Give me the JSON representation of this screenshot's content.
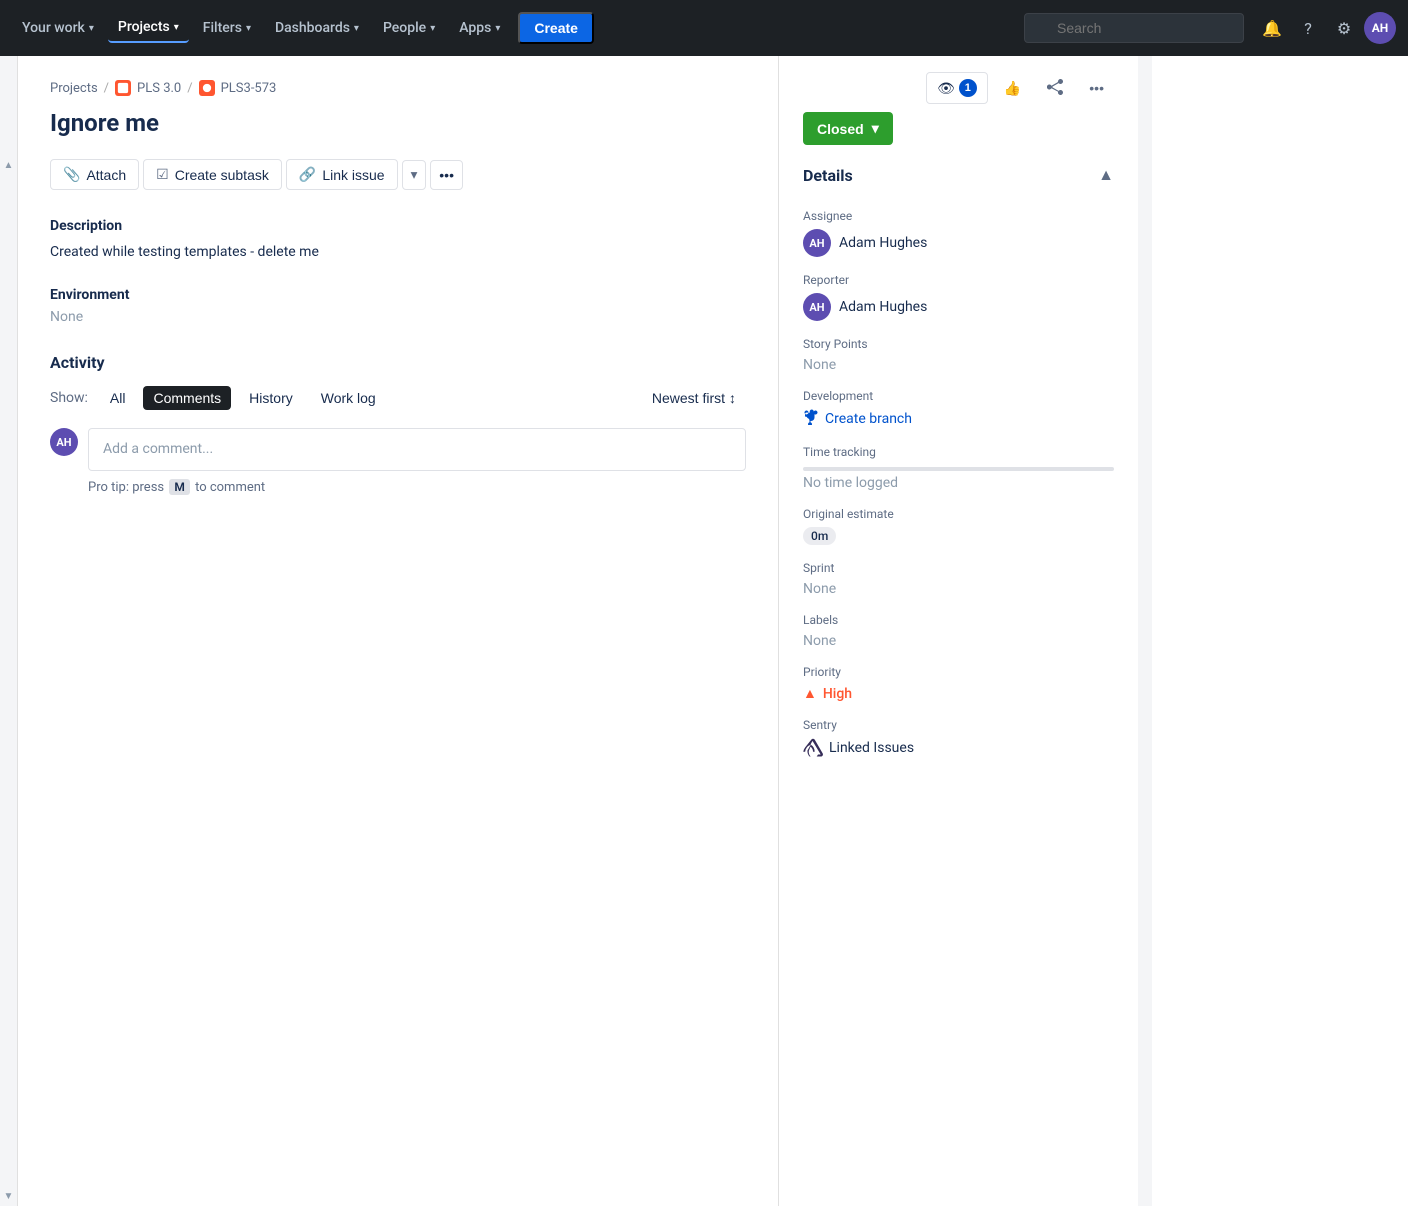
{
  "navbar": {
    "your_work": "Your work",
    "projects": "Projects",
    "filters": "Filters",
    "dashboards": "Dashboards",
    "people": "People",
    "apps": "Apps",
    "create": "Create",
    "search_placeholder": "Search",
    "avatar_initials": "AH"
  },
  "breadcrumb": {
    "projects": "Projects",
    "project_name": "PLS 3.0",
    "issue_key": "PLS3-573"
  },
  "issue": {
    "title": "Ignore me",
    "status": "Closed",
    "status_chevron": "▾"
  },
  "actions": {
    "attach": "Attach",
    "create_subtask": "Create subtask",
    "link_issue": "Link issue"
  },
  "description": {
    "label": "Description",
    "content": "Created while testing templates - delete me"
  },
  "environment": {
    "label": "Environment",
    "value": "None"
  },
  "activity": {
    "label": "Activity",
    "show_label": "Show:",
    "all": "All",
    "comments": "Comments",
    "history": "History",
    "work_log": "Work log",
    "newest_first": "Newest first",
    "comment_placeholder": "Add a comment...",
    "pro_tip_before": "Pro tip:",
    "pro_tip_key": "M",
    "pro_tip_after": "to comment",
    "avatar_initials": "AH",
    "press": "press"
  },
  "details": {
    "header": "Details",
    "assignee_label": "Assignee",
    "assignee_name": "Adam Hughes",
    "assignee_initials": "AH",
    "reporter_label": "Reporter",
    "reporter_name": "Adam Hughes",
    "reporter_initials": "AH",
    "story_points_label": "Story Points",
    "story_points_value": "None",
    "development_label": "Development",
    "create_branch": "Create branch",
    "time_tracking_label": "Time tracking",
    "no_time_logged": "No time logged",
    "original_estimate_label": "Original estimate",
    "original_estimate_value": "0m",
    "sprint_label": "Sprint",
    "sprint_value": "None",
    "labels_label": "Labels",
    "labels_value": "None",
    "priority_label": "Priority",
    "priority_value": "High",
    "sentry_label": "Sentry",
    "linked_issues": "Linked Issues"
  },
  "header_actions": {
    "watch_count": "1",
    "thumbs_up": "👍",
    "share": "share",
    "more": "..."
  }
}
